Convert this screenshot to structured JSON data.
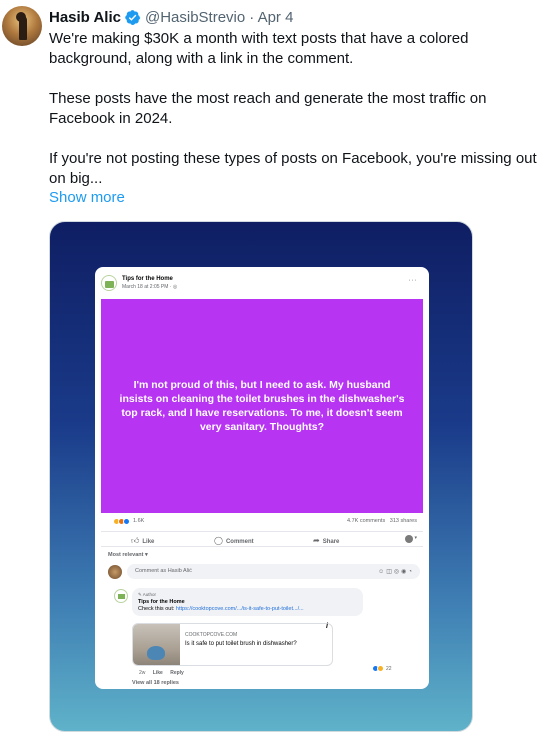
{
  "tweet": {
    "author_name": "Hasib Alic",
    "handle": "@HasibStrevio",
    "date": "· Apr 4",
    "paragraphs": [
      "We're making $30K a month with text posts that have a colored background, along with a link in the comment.",
      "These posts have the most reach and generate the most traffic on Facebook in 2024.",
      "If you're not posting these types of posts on Facebook, you're missing out on big..."
    ],
    "show_more": "Show more"
  },
  "fb_post": {
    "page_name": "Tips for the Home",
    "post_time": "March 18 at 2:05 PM · ◎",
    "more": "···",
    "post_text": "I'm not proud of this, but I need to ask. My husband insists on cleaning the toilet brushes in the dishwasher's top rack, and I have reservations. To me, it doesn't seem very sanitary. Thoughts?",
    "background_color": "#b634f2",
    "reaction_count": "1.6K",
    "comments_shares": "4.7K comments   313 shares",
    "actions": {
      "like": "Like",
      "comment": "Comment",
      "share": "Share"
    },
    "sort_label": "Most relevant ▾",
    "comment_placeholder": "Comment as Hasib Alić",
    "comment": {
      "author_tag": "✎ Author",
      "name": "Tips for the Home",
      "text_prefix": "Check this out: ",
      "link": "https://cooktopcove.com/.../is-it-safe-to-put-toilet.../...",
      "link_card": {
        "domain": "COOKTOPCOVE.COM",
        "title": "Is it safe to put toilet brush in dishwasher?"
      },
      "meta_time": "2w",
      "meta_like": "Like",
      "meta_reply": "Reply",
      "reaction_count": "22"
    },
    "view_all": "View all 18 replies"
  }
}
